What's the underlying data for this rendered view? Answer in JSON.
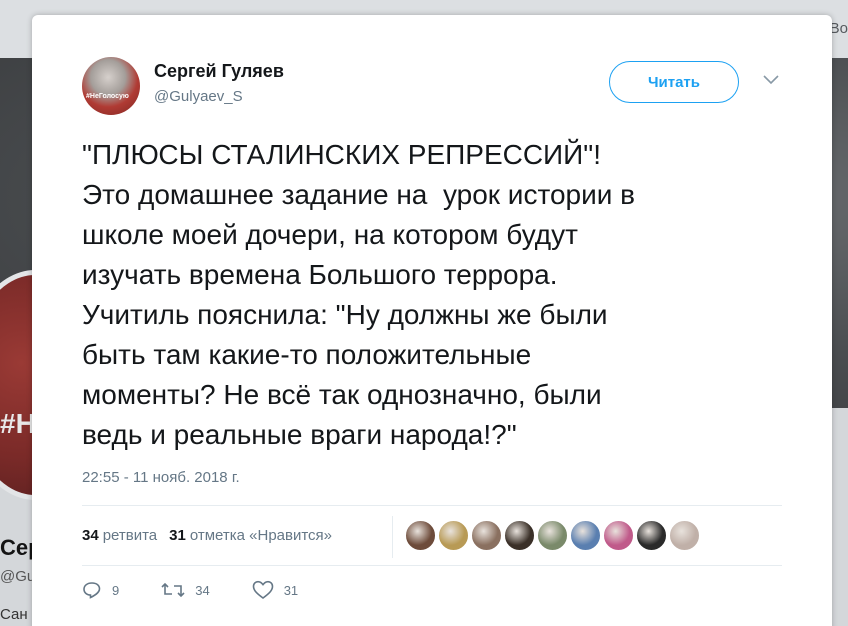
{
  "background": {
    "top_right_text": "Во",
    "avatar_tag": "#Н",
    "profile_name": "Серг",
    "profile_handle": "@Guly",
    "bottom_text": "Сан"
  },
  "tweet": {
    "author": {
      "name": "Сергей Гуляев",
      "handle": "@Gulyaev_S",
      "avatar_tag": "#НеГолосую"
    },
    "follow_label": "Читать",
    "text": "\"ПЛЮСЫ СТАЛИНСКИХ РЕПРЕССИЙ\"!\nЭто домашнее задание на  урок истории в\nшколе моей дочери, на котором будут\nизучать времена Большого террора.\nУчитиль пояснила: \"Ну должны же были\nбыть там какие-то положительные\nмоменты? Не всё так однозначно, были\nведь и реальные враги народа!?\"",
    "timestamp": "22:55 - 11 нояб. 2018 г.",
    "stats": {
      "retweets_count": "34",
      "retweets_label": "ретвита",
      "likes_count": "31",
      "likes_label": "отметка «Нравится»"
    },
    "likers": [
      "#6d4b3a",
      "#b89a55",
      "#8a7060",
      "#3a3028",
      "#7a8a6a",
      "#5a7fb0",
      "#c05a8a",
      "#2a2a2a",
      "#c0b0a8"
    ],
    "actions": {
      "reply_count": "9",
      "retweet_count": "34",
      "like_count": "31"
    }
  },
  "colors": {
    "accent": "#1da1f2",
    "secondary_text": "#657786",
    "primary_text": "#14171a"
  }
}
